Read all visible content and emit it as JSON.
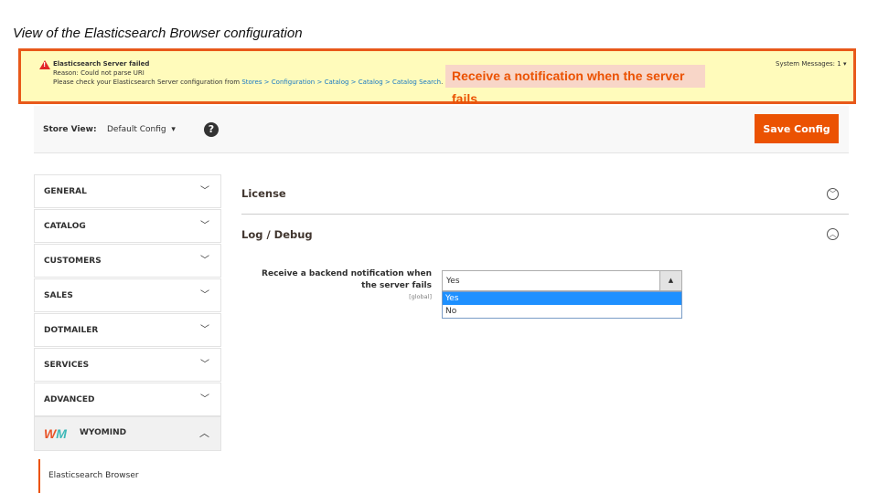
{
  "caption": "View of the Elasticsearch Browser configuration",
  "banner": {
    "title": "Elasticsearch Server failed",
    "reason": "Reason: Could not parse URI",
    "check_prefix": "Please check your Elasticsearch Server configuration from ",
    "link": "Stores > Configuration > Catalog > Catalog > Catalog Search",
    "suffix": ".",
    "system_messages": "System Messages: 1"
  },
  "callout": "Receive a notification when the server fails",
  "toolbar": {
    "store_view_label": "Store View:",
    "store_view_value": "Default Config",
    "help": "?",
    "save": "Save Config"
  },
  "sidebar": {
    "items": [
      {
        "label": "GENERAL"
      },
      {
        "label": "CATALOG"
      },
      {
        "label": "CUSTOMERS"
      },
      {
        "label": "SALES"
      },
      {
        "label": "DOTMAILER"
      },
      {
        "label": "SERVICES"
      },
      {
        "label": "ADVANCED"
      }
    ],
    "vendor": "WYOMIND",
    "vendor_logo": "WM",
    "subitem": "Elasticsearch Browser"
  },
  "main": {
    "sections": [
      {
        "title": "License"
      },
      {
        "title": "Log / Debug"
      }
    ],
    "field": {
      "label": "Receive a backend notification when the server fails",
      "scope": "[global]",
      "value": "Yes",
      "options": [
        "Yes",
        "No"
      ]
    }
  },
  "colors": {
    "accent": "#eb5202",
    "banner": "#fffbbb",
    "highlight": "#1e90ff"
  }
}
